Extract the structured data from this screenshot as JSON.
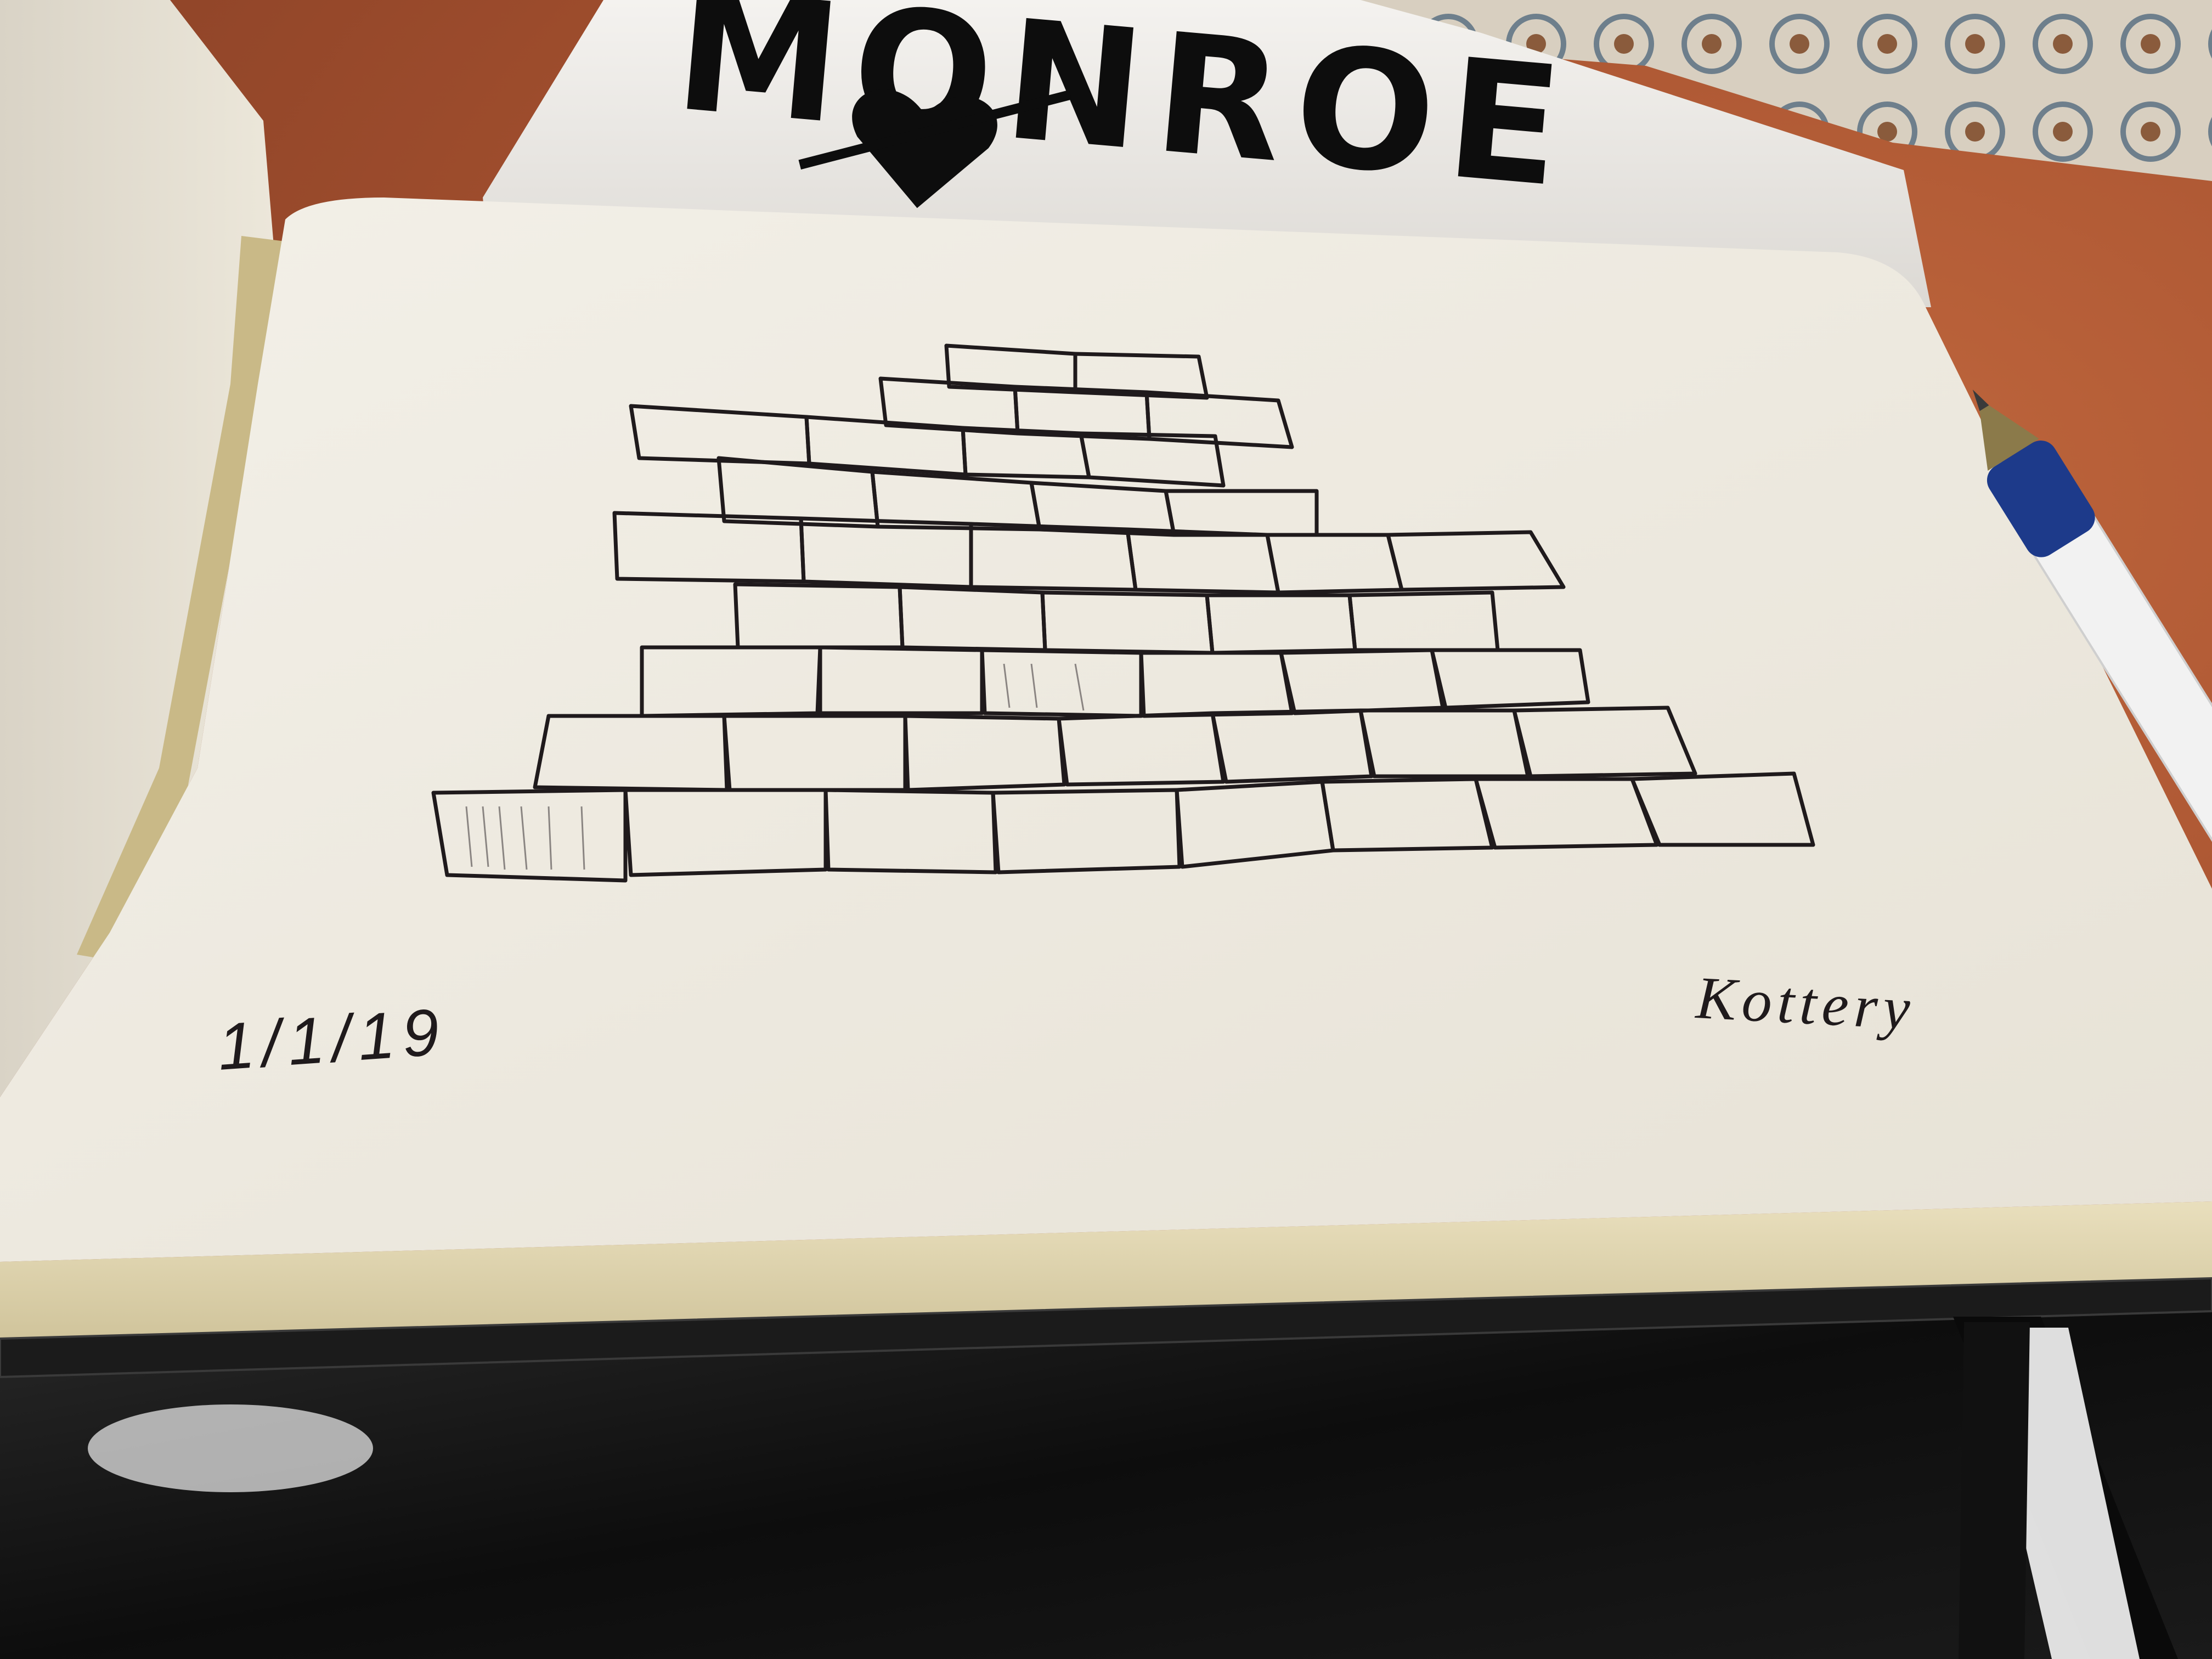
{
  "photo": {
    "background_logo_text": "MONROE",
    "sketch_date": "1/1/19",
    "sketch_signature": "Kottery",
    "colors": {
      "table_wood": "#a4502f",
      "paper": "#f1ede4",
      "ink": "#1f1a1c",
      "book_cover": "#111111",
      "pen_body": "#f2f2f2",
      "pen_grip": "#1d3a8a"
    },
    "icons": [
      "heart-icon",
      "ballpoint-pen"
    ]
  }
}
